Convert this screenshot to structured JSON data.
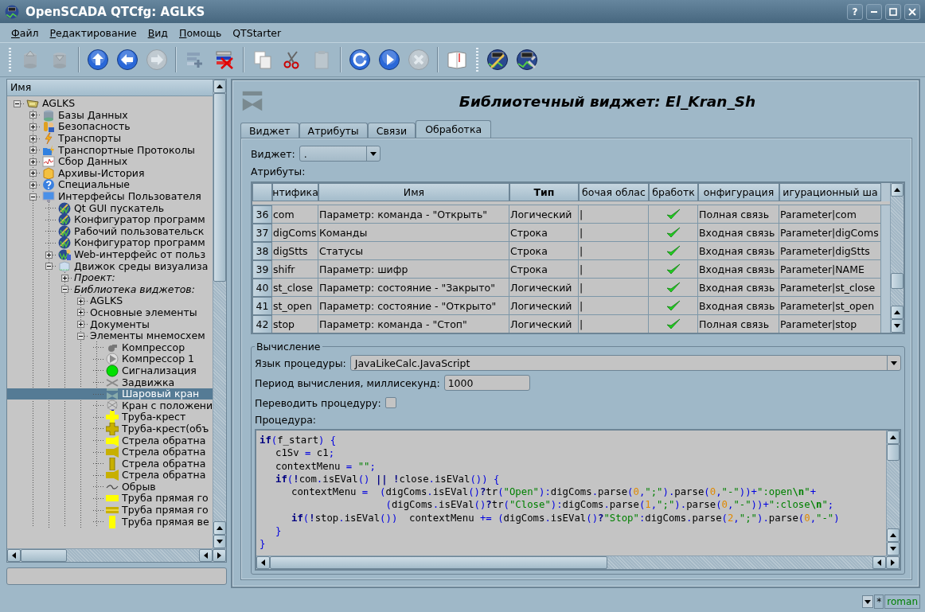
{
  "window": {
    "title": "OpenSCADA QTCfg: AGLKS",
    "help_button": "?"
  },
  "menu": [
    {
      "label": "Файл",
      "underlined": true
    },
    {
      "label": "Редактирование",
      "underlined": true
    },
    {
      "label": "Вид",
      "underlined": true
    },
    {
      "label": "Помощь",
      "underlined": true
    },
    {
      "label": "QTStarter",
      "underlined": false
    }
  ],
  "toolbar": [
    [
      {
        "kind": "db-load",
        "disabled": true
      },
      {
        "kind": "db-save",
        "disabled": true
      }
    ],
    [
      {
        "kind": "up",
        "disabled": false
      },
      {
        "kind": "back",
        "disabled": false
      },
      {
        "kind": "forward",
        "disabled": true
      }
    ],
    [
      {
        "kind": "add",
        "disabled": false
      },
      {
        "kind": "delete",
        "disabled": false
      }
    ],
    [
      {
        "kind": "copy",
        "disabled": false
      },
      {
        "kind": "cut",
        "disabled": false
      },
      {
        "kind": "paste",
        "disabled": true
      }
    ],
    [
      {
        "kind": "refresh",
        "disabled": false
      },
      {
        "kind": "start",
        "disabled": false
      },
      {
        "kind": "stop",
        "disabled": true
      }
    ],
    [
      {
        "kind": "manual",
        "disabled": false
      }
    ],
    [
      {
        "kind": "vision-run",
        "disabled": false
      },
      {
        "kind": "vision-dev",
        "disabled": false
      }
    ]
  ],
  "tree": {
    "header": "Имя",
    "items": [
      {
        "label": "AGLKS",
        "kind": "station",
        "expanded": true,
        "selected": false,
        "children": [
          {
            "label": "Базы Данных",
            "kind": "db",
            "expanded": false,
            "selected": false
          },
          {
            "label": "Безопасность",
            "kind": "security",
            "expanded": false,
            "selected": false
          },
          {
            "label": "Транспорты",
            "kind": "transport",
            "expanded": false,
            "selected": false
          },
          {
            "label": "Транспортные Протоколы",
            "kind": "protocol",
            "expanded": false,
            "selected": false
          },
          {
            "label": "Сбор Данных",
            "kind": "daq",
            "expanded": false,
            "selected": false
          },
          {
            "label": "Архивы-История",
            "kind": "archive",
            "expanded": false,
            "selected": false
          },
          {
            "label": "Специальные",
            "kind": "special",
            "expanded": false,
            "selected": false
          },
          {
            "label": "Интерфейсы Пользователя",
            "kind": "ui",
            "expanded": true,
            "selected": false,
            "children": [
              {
                "label": "Qt GUI пускатель",
                "kind": "module",
                "selected": false
              },
              {
                "label": "Конфигуратор программ",
                "kind": "module",
                "selected": false
              },
              {
                "label": "Рабочий пользовательск",
                "kind": "module",
                "selected": false
              },
              {
                "label": "Конфигуратор программ",
                "kind": "module",
                "selected": false
              },
              {
                "label": "Web-интерфейс от польз",
                "kind": "web",
                "expanded": false,
                "selected": false
              },
              {
                "label": "Движок среды визуализа",
                "kind": "engine",
                "expanded": true,
                "selected": false,
                "children": [
                  {
                    "label": "Проект:",
                    "kind": "section",
                    "expanded": false,
                    "selected": false
                  },
                  {
                    "label": "Библиотека виджетов:",
                    "kind": "section",
                    "expanded": true,
                    "selected": false,
                    "children": [
                      {
                        "label": "AGLKS",
                        "expanded": false,
                        "selected": false
                      },
                      {
                        "label": "Основные элементы",
                        "expanded": false,
                        "selected": false
                      },
                      {
                        "label": "Документы",
                        "expanded": false,
                        "selected": false
                      },
                      {
                        "label": "Элементы мнемосхем",
                        "expanded": true,
                        "selected": false,
                        "children": [
                          {
                            "label": "Компрессор",
                            "kind": "compressor",
                            "selected": false
                          },
                          {
                            "label": "Компрессор 1",
                            "kind": "play",
                            "selected": false
                          },
                          {
                            "label": "Сигнализация",
                            "kind": "lamp",
                            "selected": false
                          },
                          {
                            "label": "Задвижка",
                            "kind": "valve",
                            "selected": false
                          },
                          {
                            "label": "Шаровый кран",
                            "kind": "ball-valve",
                            "selected": true
                          },
                          {
                            "label": "Кран с положени",
                            "kind": "pos-valve",
                            "selected": false
                          },
                          {
                            "label": "Труба-крест",
                            "kind": "cross",
                            "selected": false
                          },
                          {
                            "label": "Труба-крест(объ",
                            "kind": "cross3d",
                            "selected": false
                          },
                          {
                            "label": "Стрела обратна",
                            "kind": "reducer",
                            "selected": false
                          },
                          {
                            "label": "Стрела обратна",
                            "kind": "reducer3d",
                            "selected": false
                          },
                          {
                            "label": "Стрела обратна",
                            "kind": "pipe-v3d",
                            "selected": false
                          },
                          {
                            "label": "Стрела обратна",
                            "kind": "reducer3d",
                            "selected": false
                          },
                          {
                            "label": "Обрыв",
                            "kind": "break",
                            "selected": false
                          },
                          {
                            "label": "Труба прямая го",
                            "kind": "pipe-h",
                            "selected": false
                          },
                          {
                            "label": "Труба прямая го",
                            "kind": "pipe-h3d",
                            "selected": false
                          },
                          {
                            "label": "Труба прямая ве",
                            "kind": "pipe-v",
                            "selected": false
                          }
                        ]
                      }
                    ]
                  }
                ]
              }
            ]
          }
        ]
      }
    ]
  },
  "heading": "Библиотечный виджет: El_Kran_Sh",
  "tabs": [
    {
      "label": "Виджет",
      "selected": false
    },
    {
      "label": "Атрибуты",
      "selected": false
    },
    {
      "label": "Связи",
      "selected": false
    },
    {
      "label": "Обработка",
      "selected": true
    }
  ],
  "widget_field": {
    "label": "Виджет:",
    "value": "."
  },
  "attributes": {
    "label": "Атрибуты:",
    "columns": [
      "нтифика",
      "Имя",
      "Тип",
      "бочая облас",
      "бработк",
      "онфигурация",
      "игурационный ша"
    ],
    "rows": [
      {
        "num": "36",
        "id": "com",
        "name": "Параметр: команда - \"Открыть\"",
        "type": "Логический",
        "work_area": "|",
        "processing": true,
        "config": "Полная связь",
        "template": "Parameter|com"
      },
      {
        "num": "37",
        "id": "digComs",
        "name": "Команды",
        "type": "Строка",
        "work_area": "|",
        "processing": true,
        "config": "Входная связь",
        "template": "Parameter|digComs"
      },
      {
        "num": "38",
        "id": "digStts",
        "name": "Статусы",
        "type": "Строка",
        "work_area": "|",
        "processing": true,
        "config": "Входная связь",
        "template": "Parameter|digStts"
      },
      {
        "num": "39",
        "id": "shifr",
        "name": "Параметр: шифр",
        "type": "Строка",
        "work_area": "|",
        "processing": true,
        "config": "Входная связь",
        "template": "Parameter|NAME"
      },
      {
        "num": "40",
        "id": "st_close",
        "name": "Параметр: состояние - \"Закрыто\"",
        "type": "Логический",
        "work_area": "|",
        "processing": true,
        "config": "Входная связь",
        "template": "Parameter|st_close"
      },
      {
        "num": "41",
        "id": "st_open",
        "name": "Параметр: состояние - \"Открыто\"",
        "type": "Логический",
        "work_area": "|",
        "processing": true,
        "config": "Входная связь",
        "template": "Parameter|st_open"
      },
      {
        "num": "42",
        "id": "stop",
        "name": "Параметр: команда - \"Стоп\"",
        "type": "Логический",
        "work_area": "|",
        "processing": true,
        "config": "Полная связь",
        "template": "Parameter|stop"
      }
    ]
  },
  "calculation": {
    "title": "Вычисление",
    "language": {
      "label": "Язык процедуры:",
      "value": "JavaLikeCalc.JavaScript"
    },
    "period": {
      "label": "Период вычисления, миллисекунд:",
      "value": "1000"
    },
    "translate": {
      "label": "Переводить процедуру:",
      "checked": false
    },
    "procedure_label": "Процедура:",
    "code": [
      "if(f_start) {",
      "\tc1Sv = c1;",
      "\tcontextMenu = \"\";",
      "\tif(!com.isEVal() || !close.isEVal()) {",
      "\t\tcontextMenu =  (digComs.isEVal()?tr(\"Open\"):digComs.parse(0,\";\").parse(0,\"-\"))+\":open\\n\"+",
      "\t\t                (digComs.isEVal()?tr(\"Close\"):digComs.parse(1,\";\").parse(0,\"-\"))+\":close\\n\";",
      "\t\tif(!stop.isEVal())  contextMenu += (digComs.isEVal()?\"Stop\":digComs.parse(2,\";\").parse(0,\"-\")",
      "\t}",
      "}"
    ]
  },
  "status_bar": {
    "marker": "*",
    "user": "roman"
  }
}
